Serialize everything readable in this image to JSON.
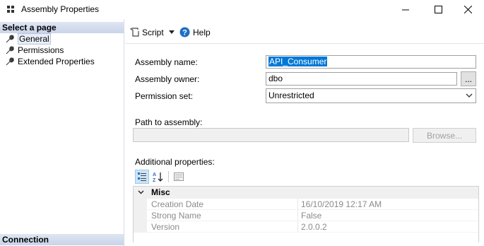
{
  "window": {
    "title": "Assembly Properties",
    "app_icon": "grid-app-icon",
    "controls": {
      "minimize": "minimize-icon",
      "maximize": "maximize-icon",
      "close": "close-icon"
    }
  },
  "sidebar": {
    "select_page_header": "Select a page",
    "items": [
      {
        "label": "General",
        "icon": "wrench-icon",
        "selected": true
      },
      {
        "label": "Permissions",
        "icon": "wrench-icon",
        "selected": false
      },
      {
        "label": "Extended Properties",
        "icon": "wrench-icon",
        "selected": false
      }
    ],
    "connection_header": "Connection"
  },
  "toolbar": {
    "script_label": "Script",
    "help_label": "Help"
  },
  "form": {
    "assembly_name_label": "Assembly name:",
    "assembly_name_value": "API_Consumer",
    "assembly_owner_label": "Assembly owner:",
    "assembly_owner_value": "dbo",
    "browse_owner_label": "...",
    "permission_set_label": "Permission set:",
    "permission_set_value": "Unrestricted",
    "path_label": "Path to assembly:",
    "path_value": "",
    "browse_label": "Browse...",
    "additional_label": "Additional properties:"
  },
  "properties": {
    "category": "Misc",
    "rows": [
      {
        "name": "Creation Date",
        "value": "16/10/2019 12:17 AM"
      },
      {
        "name": "Strong Name",
        "value": "False"
      },
      {
        "name": "Version",
        "value": "2.0.0.2"
      }
    ]
  },
  "colors": {
    "selection": "#0078d7",
    "section_header": "#dfe6f3",
    "help_icon": "#1f6fc5"
  }
}
